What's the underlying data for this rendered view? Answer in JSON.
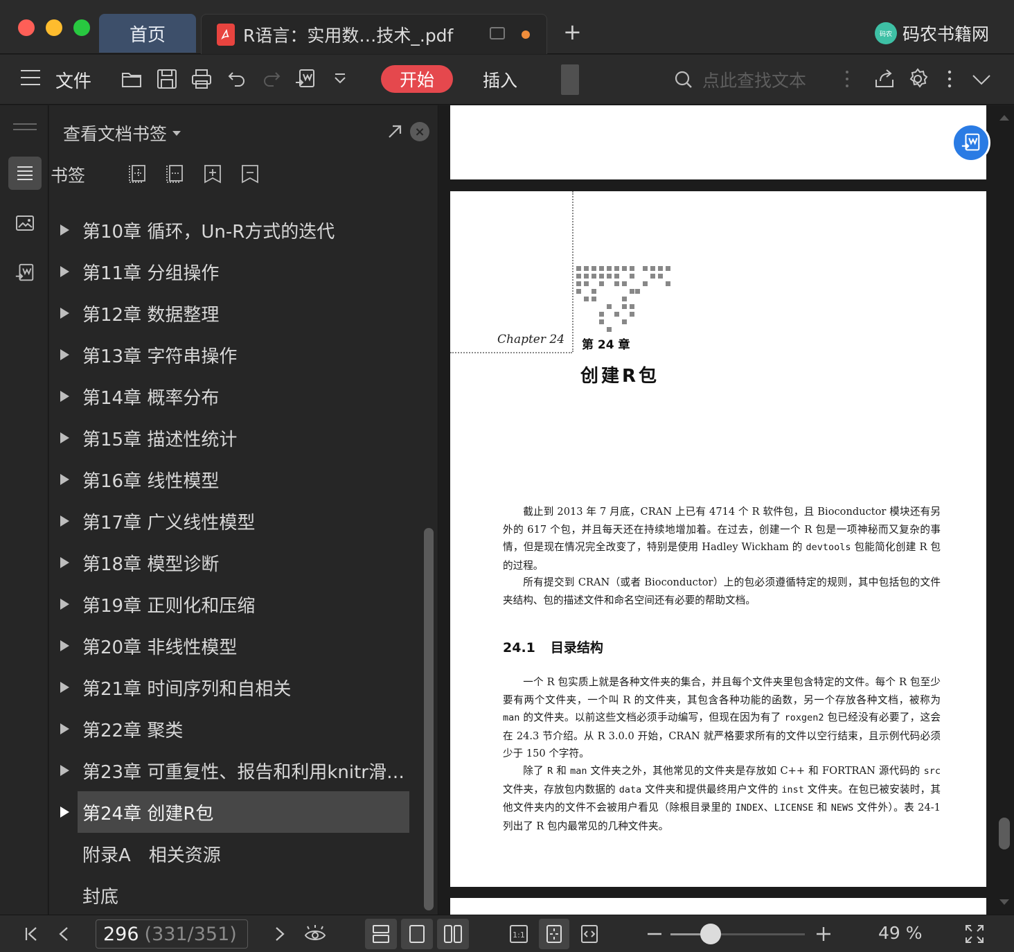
{
  "titlebar": {
    "home_tab": "首页",
    "doc_tab_icon": "pdf-file-icon",
    "doc_tab_title": "R语言：实用数…技术_.pdf",
    "brand_logo_text": "码农",
    "brand_name": "码农书籍网",
    "unsaved_dot_color": "#f08d3b"
  },
  "toolbar": {
    "file_label": "文件",
    "start_label": "开始",
    "insert_label": "插入",
    "search_placeholder": "点此查找文本",
    "accent_color": "#e5484d"
  },
  "panel": {
    "title": "查看文档书签",
    "bookmarks_label": "书签",
    "items": [
      {
        "label": "第10章 循环，Un-R方式的迭代",
        "expandable": true
      },
      {
        "label": "第11章 分组操作",
        "expandable": true
      },
      {
        "label": "第12章 数据整理",
        "expandable": true
      },
      {
        "label": "第13章 字符串操作",
        "expandable": true
      },
      {
        "label": "第14章 概率分布",
        "expandable": true
      },
      {
        "label": "第15章 描述性统计",
        "expandable": true
      },
      {
        "label": "第16章 线性模型",
        "expandable": true
      },
      {
        "label": "第17章 广义线性模型",
        "expandable": true
      },
      {
        "label": "第18章 模型诊断",
        "expandable": true
      },
      {
        "label": "第19章 正则化和压缩",
        "expandable": true
      },
      {
        "label": "第20章 非线性模型",
        "expandable": true
      },
      {
        "label": "第21章 时间序列和自相关",
        "expandable": true
      },
      {
        "label": "第22章 聚类",
        "expandable": true
      },
      {
        "label": "第23章 可重复性、报告和利用knitr滑…",
        "expandable": true
      },
      {
        "label": "第24章 创建R包",
        "expandable": true,
        "selected": true
      },
      {
        "label": "附录A　相关资源",
        "expandable": false
      },
      {
        "label": "封底",
        "expandable": false
      }
    ]
  },
  "document": {
    "chapter_script": "Chapter 24",
    "chapter_number": "第 24 章",
    "chapter_title": "创建R包",
    "p1_a": "截止到 2013 年 7 月底，CRAN 上已有 4714 个 R 软件包，且 Bioconductor 模块还有另外的 617 个包，并且每天还在持续地增加着。在过去，创建一个 R 包是一项神秘而又复杂的事情，但是现在情况完全改变了，特别是使用 Hadley Wickham 的 ",
    "p1_code": "devtools",
    "p1_b": " 包能简化创建 R 包的过程。",
    "p2": "所有提交到 CRAN（或者 Bioconductor）上的包必须遵循特定的规则，其中包括包的文件夹结构、包的描述文件和命名空间还有必要的帮助文档。",
    "section_number": "24.1",
    "section_title": "目录结构",
    "p3_a": "一个 R 包实质上就是各种文件夹的集合，并且每个文件夹里包含特定的文件。每个 R 包至少要有两个文件夹，一个叫 R 的文件夹，其包含各种功能的函数，另一个存放各种文档，被称为 ",
    "p3_code1": "man",
    "p3_b": " 的文件夹。以前这些文档必须手动编写，但现在因为有了 ",
    "p3_code2": "roxgen2",
    "p3_c": " 包已经没有必要了，这会在 24.3 节介绍。从 R 3.0.0 开始，CRAN 就严格要求所有的文件以空行结束，且示例代码必须少于 150 个字符。",
    "p4_a": "除了 ",
    "p4_code1": "R",
    "p4_b": " 和 ",
    "p4_code2": "man",
    "p4_c": " 文件夹之外，其他常见的文件夹是存放如 C++ 和 FORTRAN 源代码的 ",
    "p4_code3": "src",
    "p4_d": " 文件夹，存放包内数据的 ",
    "p4_code4": "data",
    "p4_e": " 文件夹和提供最终用户文件的 ",
    "p4_code5": "inst",
    "p4_f": " 文件夹。在包已被安装时，其他文件夹内的文件不会被用户看见（除根目录里的 ",
    "p4_code6": "INDEX",
    "p4_g": "、",
    "p4_code7": "LICENSE",
    "p4_h": " 和 ",
    "p4_code8": "NEWS",
    "p4_i": " 文件外）。表 24-1 列出了 R 包内最常见的几种文件夹。"
  },
  "statusbar": {
    "current_page": "296",
    "page_position": "(331/351)",
    "zoom_label": "49 %",
    "zoom_fraction": 0.3
  }
}
